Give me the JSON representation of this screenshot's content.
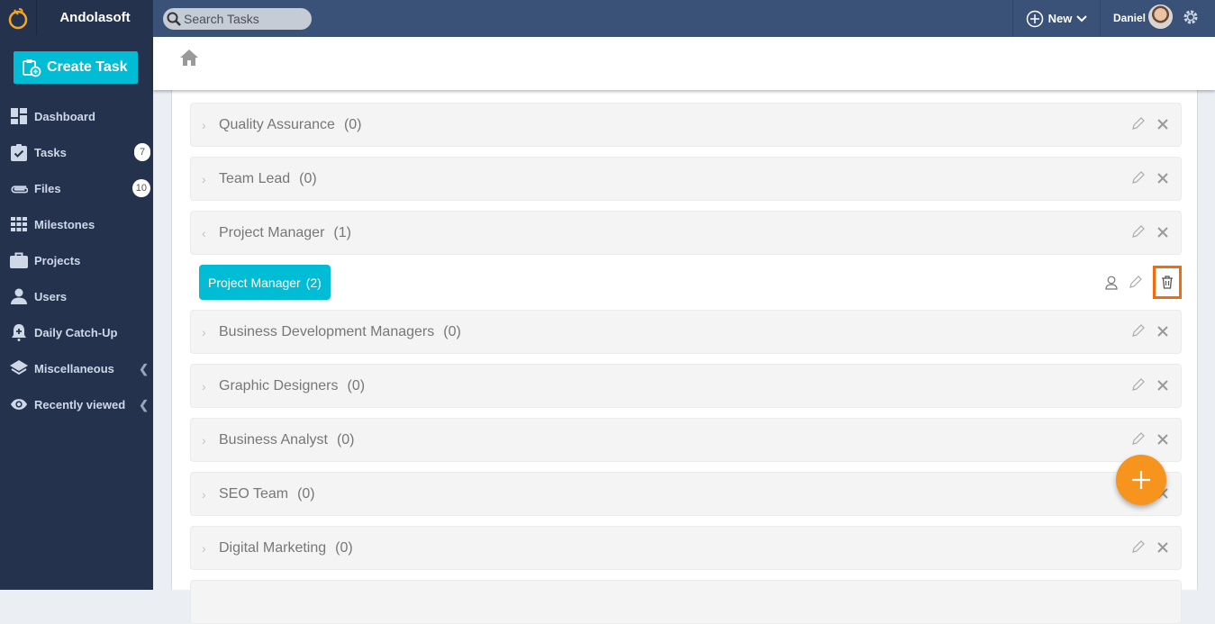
{
  "header": {
    "brand_name": "Andolasoft",
    "search_placeholder": "Search Tasks",
    "new_label": "New",
    "user_name": "Daniel"
  },
  "sidebar": {
    "create_task_label": "Create Task",
    "items": [
      {
        "label": "Dashboard",
        "icon": "dashboard-icon"
      },
      {
        "label": "Tasks",
        "icon": "tasks-icon",
        "badge": "7"
      },
      {
        "label": "Files",
        "icon": "paperclip-icon",
        "badge": "10"
      },
      {
        "label": "Milestones",
        "icon": "grid-icon"
      },
      {
        "label": "Projects",
        "icon": "briefcase-icon"
      },
      {
        "label": "Users",
        "icon": "user-icon"
      },
      {
        "label": "Daily Catch-Up",
        "icon": "bell-plus-icon"
      },
      {
        "label": "Miscellaneous",
        "icon": "layers-icon",
        "expandable": true
      },
      {
        "label": "Recently viewed",
        "icon": "eye-icon",
        "expandable": true
      }
    ]
  },
  "groups": [
    {
      "name": "Quality Assurance",
      "count": "(0)",
      "expanded": false
    },
    {
      "name": "Team Lead",
      "count": "(0)",
      "expanded": false
    },
    {
      "name": "Project Manager",
      "count": "(1)",
      "expanded": true
    },
    {
      "name": "Business Development Managers",
      "count": "(0)",
      "expanded": false
    },
    {
      "name": "Graphic Designers",
      "count": "(0)",
      "expanded": false
    },
    {
      "name": "Business Analyst",
      "count": "(0)",
      "expanded": false
    },
    {
      "name": "SEO Team",
      "count": "(0)",
      "expanded": false
    },
    {
      "name": "Digital Marketing",
      "count": "(0)",
      "expanded": false
    }
  ],
  "subgroup": {
    "name": "Project Manager",
    "count": "(2)"
  },
  "colors": {
    "accent": "#00bcd4",
    "sidebar": "#24324d",
    "topbar": "#3a5277",
    "fab": "#f7941d",
    "highlight": "#f26b0f"
  }
}
